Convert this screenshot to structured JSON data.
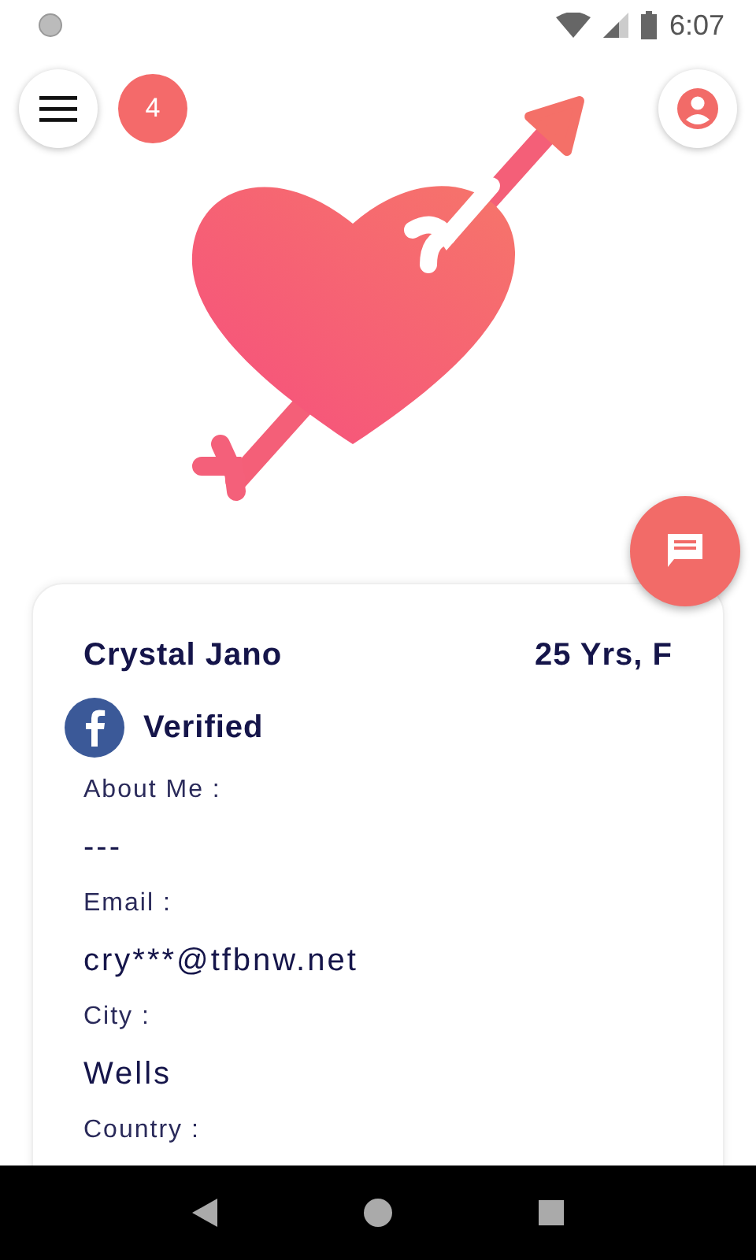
{
  "status_bar": {
    "time": "6:07"
  },
  "notification_badge": "4",
  "profile": {
    "name": "Crystal Jano",
    "age_gender": "25 Yrs, F",
    "verification": "Verified"
  },
  "fields": [
    {
      "label": "About Me :",
      "value": "---"
    },
    {
      "label": "Email :",
      "value": "cry***@tfbnw.net"
    },
    {
      "label": "City :",
      "value": "Wells"
    },
    {
      "label": "Country :"
    }
  ]
}
